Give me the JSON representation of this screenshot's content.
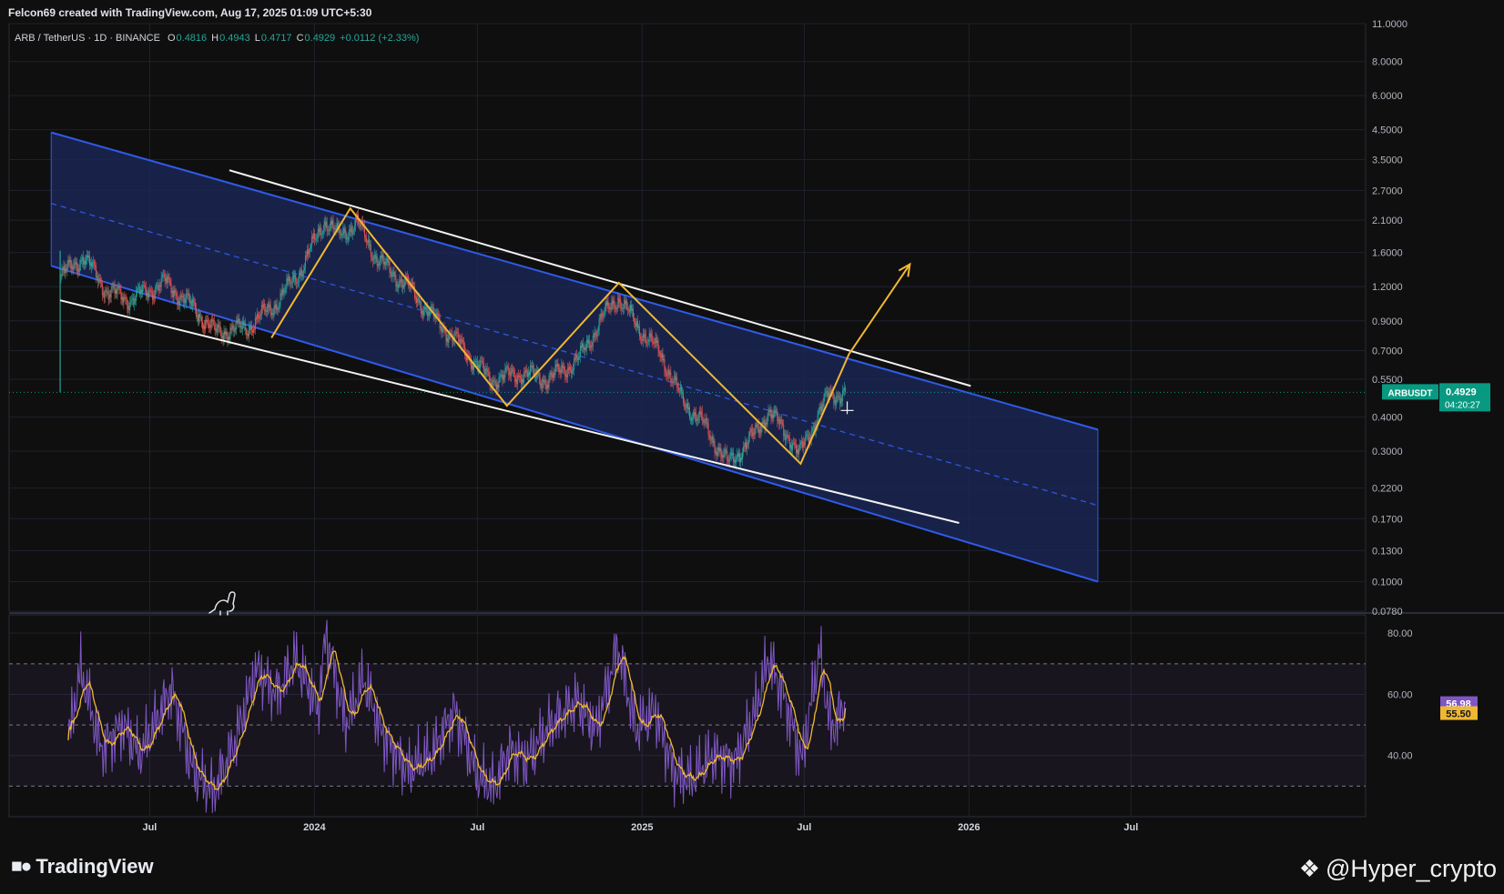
{
  "header": {
    "credit": "Felcon69 created with TradingView.com, Aug 17, 2025 01:09 UTC+5:30"
  },
  "legend": {
    "symbol": "ARB / TetherUS · 1D · BINANCE",
    "o_label": "O",
    "o_value": "0.4816",
    "h_label": "H",
    "h_value": "0.4943",
    "l_label": "L",
    "l_value": "0.4717",
    "c_label": "C",
    "c_value": "0.4929",
    "change": "+0.0112 (+2.33%)"
  },
  "price_badge": {
    "ticker": "ARBUSDT",
    "price": "0.4929",
    "countdown": "04:20:27"
  },
  "rsi_badges": {
    "rsi": "56.98",
    "ma": "55.50"
  },
  "brand": {
    "name": "TradingView",
    "logo_icon": "tradingview-logo-icon"
  },
  "watermark": {
    "text": "@Hyper_crypto",
    "icon": "binance-diamond-icon"
  },
  "colors": {
    "background": "#0f0f0f",
    "channel_fill": "#1a2654",
    "channel_line": "#2f5bea",
    "pattern": "#f0b832",
    "up_candle": "#26a69a",
    "down_candle": "#ef5350",
    "rsi_line": "#7e57c2",
    "rsi_ma": "#f0b832",
    "badge_price": "#089981"
  },
  "chart_data": [
    {
      "type": "candlestick",
      "symbol": "ARB / TetherUS",
      "interval": "1D",
      "exchange": "BINANCE",
      "y_scale": "log",
      "y_ticks": [
        "11.0000",
        "8.0000",
        "6.0000",
        "4.5000",
        "3.5000",
        "2.7000",
        "2.1000",
        "1.6000",
        "1.2000",
        "0.9000",
        "0.7000",
        "0.5500",
        "0.4000",
        "0.3000",
        "0.2200",
        "0.1700",
        "0.1300",
        "0.1000",
        "0.0780"
      ],
      "y_tick_values": [
        11,
        8,
        6,
        4.5,
        3.5,
        2.7,
        2.1,
        1.6,
        1.2,
        0.9,
        0.7,
        0.55,
        0.4,
        0.3,
        0.22,
        0.17,
        0.13,
        0.1,
        0.078
      ],
      "ylim": [
        0.078,
        11
      ],
      "x_ticks": [
        {
          "label": "Jul",
          "date": "2023-07-01"
        },
        {
          "label": "2024",
          "date": "2024-01-01"
        },
        {
          "label": "Jul",
          "date": "2024-07-01"
        },
        {
          "label": "2025",
          "date": "2025-01-01"
        },
        {
          "label": "Jul",
          "date": "2025-07-01"
        },
        {
          "label": "2026",
          "date": "2026-01-01"
        },
        {
          "label": "Jul",
          "date": "2026-07-01"
        }
      ],
      "xlim": [
        "2023-01-25",
        "2027-03-20"
      ],
      "last_price": 0.4929,
      "price_path": [
        {
          "date": "2023-03-23",
          "close": 1.3
        },
        {
          "date": "2023-04-18",
          "close": 1.55
        },
        {
          "date": "2023-05-15",
          "close": 1.15
        },
        {
          "date": "2023-06-10",
          "close": 1.08
        },
        {
          "date": "2023-07-18",
          "close": 1.25
        },
        {
          "date": "2023-08-20",
          "close": 1.0
        },
        {
          "date": "2023-09-12",
          "close": 0.82
        },
        {
          "date": "2023-10-18",
          "close": 0.85
        },
        {
          "date": "2023-11-20",
          "close": 1.05
        },
        {
          "date": "2023-12-18",
          "close": 1.4
        },
        {
          "date": "2024-01-12",
          "close": 2.1
        },
        {
          "date": "2024-01-28",
          "close": 1.85
        },
        {
          "date": "2024-02-18",
          "close": 2.05
        },
        {
          "date": "2024-03-12",
          "close": 1.5
        },
        {
          "date": "2024-04-15",
          "close": 1.2
        },
        {
          "date": "2024-05-10",
          "close": 0.95
        },
        {
          "date": "2024-06-10",
          "close": 0.75
        },
        {
          "date": "2024-07-15",
          "close": 0.55
        },
        {
          "date": "2024-08-20",
          "close": 0.58
        },
        {
          "date": "2024-09-18",
          "close": 0.55
        },
        {
          "date": "2024-10-22",
          "close": 0.65
        },
        {
          "date": "2024-11-20",
          "close": 0.95
        },
        {
          "date": "2024-12-05",
          "close": 1.1
        },
        {
          "date": "2024-12-28",
          "close": 0.85
        },
        {
          "date": "2025-01-22",
          "close": 0.68
        },
        {
          "date": "2025-02-15",
          "close": 0.46
        },
        {
          "date": "2025-03-10",
          "close": 0.38
        },
        {
          "date": "2025-04-07",
          "close": 0.27
        },
        {
          "date": "2025-05-05",
          "close": 0.34
        },
        {
          "date": "2025-05-22",
          "close": 0.42
        },
        {
          "date": "2025-06-15",
          "close": 0.34
        },
        {
          "date": "2025-06-25",
          "close": 0.29
        },
        {
          "date": "2025-07-15",
          "close": 0.4
        },
        {
          "date": "2025-07-28",
          "close": 0.48
        },
        {
          "date": "2025-08-16",
          "close": 0.4929
        }
      ],
      "descending_channel": {
        "upper": [
          {
            "date": "2023-03-13",
            "price": 4.4
          },
          {
            "date": "2026-05-25",
            "price": 0.36
          }
        ],
        "lower": [
          {
            "date": "2023-03-13",
            "price": 1.43
          },
          {
            "date": "2026-05-25",
            "price": 0.1
          }
        ],
        "middle": [
          {
            "date": "2023-03-13",
            "price": 2.42
          },
          {
            "date": "2026-05-25",
            "price": 0.19
          }
        ]
      },
      "trendlines": [
        {
          "from": {
            "date": "2023-09-28",
            "price": 3.2
          },
          "to": {
            "date": "2026-01-03",
            "price": 0.52
          }
        },
        {
          "from": {
            "date": "2023-03-23",
            "price": 1.07
          },
          "to": {
            "date": "2025-12-21",
            "price": 0.164
          }
        }
      ],
      "zigzag_pattern": [
        {
          "date": "2023-11-14",
          "price": 0.78
        },
        {
          "date": "2024-02-10",
          "price": 2.32
        },
        {
          "date": "2024-08-03",
          "price": 0.44
        },
        {
          "date": "2024-12-06",
          "price": 1.24
        },
        {
          "date": "2025-06-27",
          "price": 0.27
        },
        {
          "date": "2025-08-20",
          "price": 0.68
        },
        {
          "date": "2025-10-27",
          "price": 1.45
        }
      ]
    },
    {
      "type": "line",
      "indicator": "RSI",
      "y_ticks": [
        "80.00",
        "60.00",
        "40.00"
      ],
      "y_tick_values": [
        80,
        60,
        40
      ],
      "ylim": [
        20,
        86
      ],
      "bands": [
        70,
        50,
        30
      ],
      "last_rsi": 56.98,
      "last_ma": 55.5,
      "rsi_path": [
        {
          "date": "2023-04-01",
          "rsi": 45
        },
        {
          "date": "2023-04-15",
          "rsi": 68
        },
        {
          "date": "2023-05-08",
          "rsi": 42
        },
        {
          "date": "2023-06-01",
          "rsi": 50
        },
        {
          "date": "2023-06-20",
          "rsi": 40
        },
        {
          "date": "2023-07-25",
          "rsi": 62
        },
        {
          "date": "2023-08-18",
          "rsi": 35
        },
        {
          "date": "2023-09-10",
          "rsi": 28
        },
        {
          "date": "2023-10-05",
          "rsi": 45
        },
        {
          "date": "2023-10-28",
          "rsi": 68
        },
        {
          "date": "2023-11-20",
          "rsi": 60
        },
        {
          "date": "2023-12-10",
          "rsi": 72
        },
        {
          "date": "2024-01-05",
          "rsi": 55
        },
        {
          "date": "2024-01-14",
          "rsi": 80
        },
        {
          "date": "2024-02-05",
          "rsi": 50
        },
        {
          "date": "2024-02-25",
          "rsi": 65
        },
        {
          "date": "2024-03-15",
          "rsi": 48
        },
        {
          "date": "2024-04-15",
          "rsi": 35
        },
        {
          "date": "2024-05-10",
          "rsi": 40
        },
        {
          "date": "2024-06-05",
          "rsi": 55
        },
        {
          "date": "2024-07-01",
          "rsi": 33
        },
        {
          "date": "2024-07-20",
          "rsi": 30
        },
        {
          "date": "2024-08-05",
          "rsi": 42
        },
        {
          "date": "2024-08-25",
          "rsi": 38
        },
        {
          "date": "2024-09-20",
          "rsi": 50
        },
        {
          "date": "2024-10-20",
          "rsi": 58
        },
        {
          "date": "2024-11-10",
          "rsi": 48
        },
        {
          "date": "2024-12-05",
          "rsi": 76
        },
        {
          "date": "2024-12-25",
          "rsi": 48
        },
        {
          "date": "2025-01-15",
          "rsi": 55
        },
        {
          "date": "2025-02-05",
          "rsi": 35
        },
        {
          "date": "2025-02-25",
          "rsi": 32
        },
        {
          "date": "2025-03-20",
          "rsi": 40
        },
        {
          "date": "2025-04-15",
          "rsi": 38
        },
        {
          "date": "2025-05-08",
          "rsi": 55
        },
        {
          "date": "2025-05-22",
          "rsi": 72
        },
        {
          "date": "2025-06-10",
          "rsi": 58
        },
        {
          "date": "2025-06-28",
          "rsi": 38
        },
        {
          "date": "2025-07-18",
          "rsi": 74
        },
        {
          "date": "2025-07-31",
          "rsi": 48
        },
        {
          "date": "2025-08-16",
          "rsi": 56.98
        }
      ]
    }
  ]
}
